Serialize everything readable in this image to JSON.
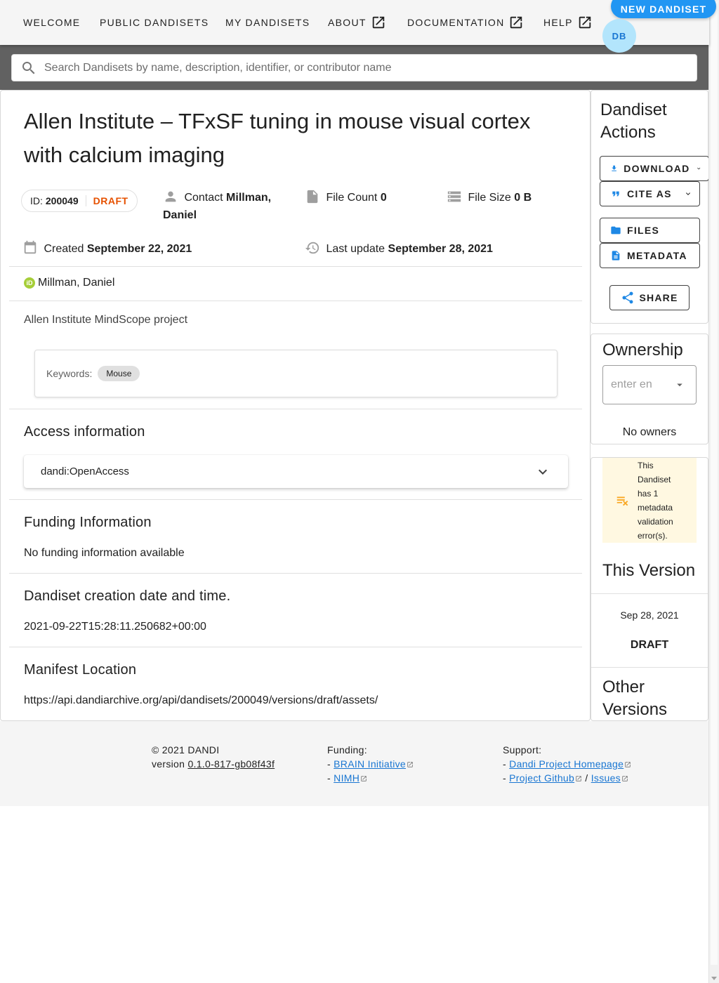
{
  "nav": {
    "welcome": "WELCOME",
    "public": "PUBLIC DANDISETS",
    "my": "MY DANDISETS",
    "about": "ABOUT",
    "docs": "DOCUMENTATION",
    "help": "HELP",
    "new_dandiset": "NEW DANDISET",
    "avatar_initials": "DB"
  },
  "search": {
    "placeholder": "Search Dandisets by name, description, identifier, or contributor name"
  },
  "dandiset": {
    "title": "Allen Institute – TFxSF tuning in mouse visual cortex with calcium imaging",
    "id_label": "ID:",
    "id": "200049",
    "status": "DRAFT",
    "contact_label": "Contact",
    "contact_name": "Millman, Daniel",
    "file_count_label": "File Count",
    "file_count": "0",
    "file_size_label": "File Size",
    "file_size": "0 B",
    "created_label": "Created",
    "created": "September 22, 2021",
    "updated_label": "Last update",
    "updated": "September 28, 2021",
    "contributor": "Millman, Daniel",
    "orcid_badge": "iD",
    "description": "Allen Institute MindScope project",
    "keywords_label": "Keywords:",
    "keywords": [
      "Mouse"
    ]
  },
  "sections": {
    "access_title": "Access information",
    "access_value": "dandi:OpenAccess",
    "funding_title": "Funding Information",
    "funding_value": "No funding information available",
    "creation_title": "Dandiset creation date and time.",
    "creation_value": "2021-09-22T15:28:11.250682+00:00",
    "manifest_title": "Manifest Location",
    "manifest_value": "https://api.dandiarchive.org/api/dandisets/200049/versions/draft/assets/"
  },
  "actions": {
    "title": "Dandiset Actions",
    "download": "DOWNLOAD",
    "cite": "CITE AS",
    "files": "FILES",
    "metadata": "METADATA",
    "share": "SHARE"
  },
  "ownership": {
    "title": "Ownership",
    "placeholder": "enter en",
    "empty": "No owners"
  },
  "validation": {
    "message": "This Dandiset has 1 metadata validation error(s)."
  },
  "version": {
    "title": "This Version",
    "date": "Sep 28, 2021",
    "label": "DRAFT",
    "other_title": "Other Versions"
  },
  "footer": {
    "copyright": "© 2021 DANDI",
    "version_label": "version",
    "version": "0.1.0-817-gb08f43f",
    "funding_label": "Funding:",
    "funding_1": "BRAIN Initiative",
    "funding_2": "NIMH",
    "support_label": "Support:",
    "support_1": "Dandi Project Homepage",
    "support_2": "Project Github",
    "support_sep": "/",
    "support_3": "Issues",
    "dash": "-"
  },
  "colors": {
    "accent": "#2196f3",
    "draft": "#e65100",
    "warning_bg": "#fff8e1",
    "warning_icon": "#f9a825",
    "folder_icon": "#2196f3"
  }
}
